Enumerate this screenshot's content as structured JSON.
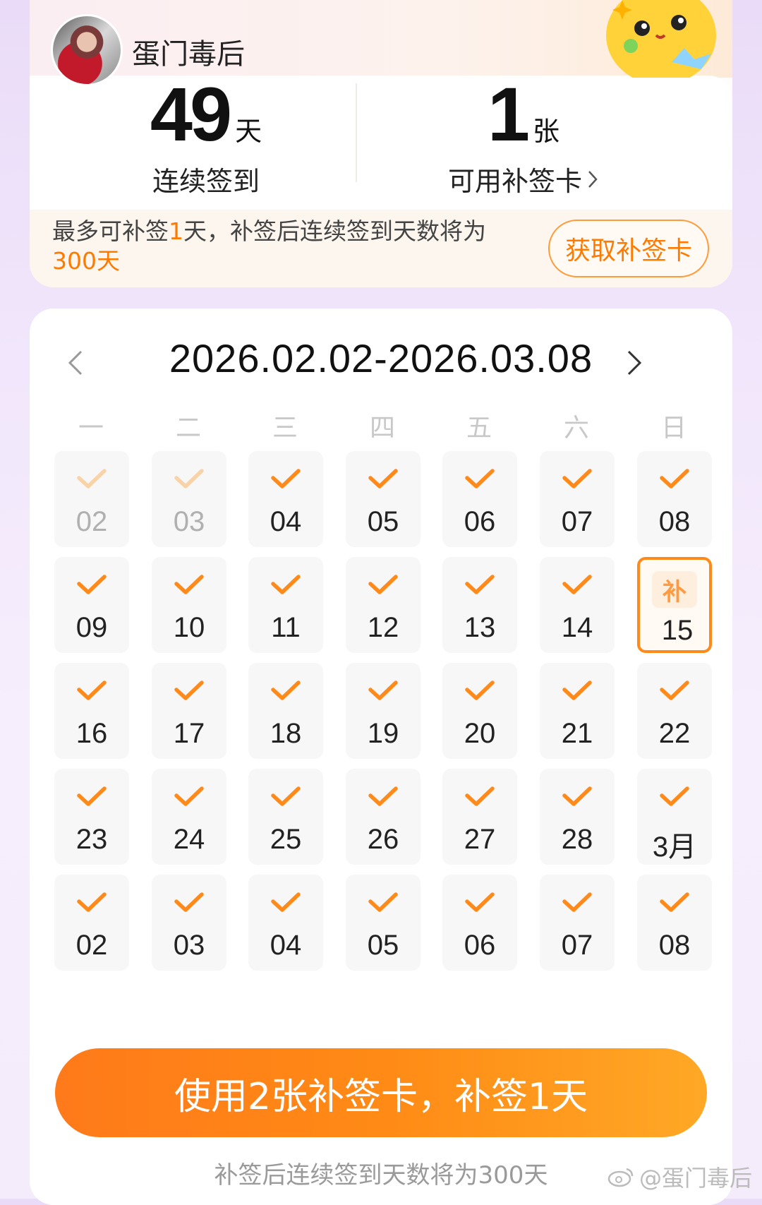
{
  "header": {
    "username": "蛋门毒后",
    "stats": {
      "streak": {
        "value": "49",
        "unit": "天",
        "label": "连续签到"
      },
      "cards": {
        "value": "1",
        "unit": "张",
        "label": "可用补签卡"
      }
    },
    "notice": {
      "prefix": "最多可补签",
      "count": "1",
      "middle": "天，补签后连续签到天数将为",
      "total": "300天"
    },
    "get_card_button": "获取补签卡"
  },
  "calendar": {
    "range": "2026.02.02-2026.03.08",
    "weekdays": [
      "一",
      "二",
      "三",
      "四",
      "五",
      "六",
      "日"
    ],
    "makeup_badge": "补",
    "days": [
      {
        "label": "02",
        "state": "past"
      },
      {
        "label": "03",
        "state": "past"
      },
      {
        "label": "04",
        "state": "checked"
      },
      {
        "label": "05",
        "state": "checked"
      },
      {
        "label": "06",
        "state": "checked"
      },
      {
        "label": "07",
        "state": "checked"
      },
      {
        "label": "08",
        "state": "checked"
      },
      {
        "label": "09",
        "state": "checked"
      },
      {
        "label": "10",
        "state": "checked"
      },
      {
        "label": "11",
        "state": "checked"
      },
      {
        "label": "12",
        "state": "checked"
      },
      {
        "label": "13",
        "state": "checked"
      },
      {
        "label": "14",
        "state": "checked"
      },
      {
        "label": "15",
        "state": "makeup"
      },
      {
        "label": "16",
        "state": "checked"
      },
      {
        "label": "17",
        "state": "checked"
      },
      {
        "label": "18",
        "state": "checked"
      },
      {
        "label": "19",
        "state": "checked"
      },
      {
        "label": "20",
        "state": "checked"
      },
      {
        "label": "21",
        "state": "checked"
      },
      {
        "label": "22",
        "state": "checked"
      },
      {
        "label": "23",
        "state": "checked"
      },
      {
        "label": "24",
        "state": "checked"
      },
      {
        "label": "25",
        "state": "checked"
      },
      {
        "label": "26",
        "state": "checked"
      },
      {
        "label": "27",
        "state": "checked"
      },
      {
        "label": "28",
        "state": "checked"
      },
      {
        "label": "3月",
        "state": "checked"
      },
      {
        "label": "02",
        "state": "checked"
      },
      {
        "label": "03",
        "state": "checked"
      },
      {
        "label": "04",
        "state": "checked"
      },
      {
        "label": "05",
        "state": "checked"
      },
      {
        "label": "06",
        "state": "checked"
      },
      {
        "label": "07",
        "state": "checked"
      },
      {
        "label": "08",
        "state": "checked"
      }
    ]
  },
  "action": {
    "main_button": "使用2张补签卡，补签1天",
    "footnote": "补签后连续签到天数将为300天"
  },
  "watermark": "@蛋门毒后",
  "colors": {
    "accent": "#ff7a00",
    "check": "#ff8a1a",
    "past_check": "#f9d3a8"
  }
}
